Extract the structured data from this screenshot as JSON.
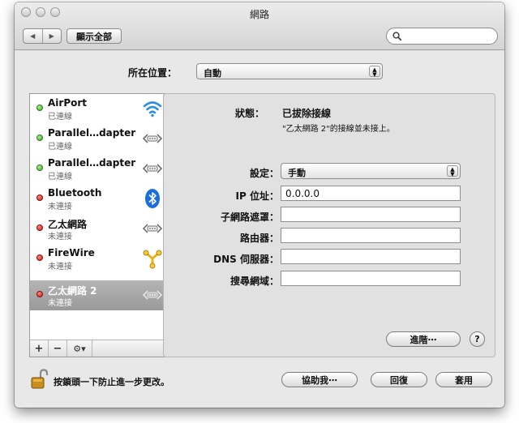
{
  "window": {
    "title": "網路"
  },
  "toolbar": {
    "back_symbol": "◀",
    "forward_symbol": "▶",
    "show_all_label": "顯示全部",
    "search_value": ""
  },
  "location": {
    "label": "所在位置：",
    "value": "自動"
  },
  "services": [
    {
      "name": "AirPort",
      "status": "已連線",
      "state": "green",
      "icon": "wifi-icon"
    },
    {
      "name": "Parallel…dapter",
      "status": "已連線",
      "state": "green",
      "icon": "ethernet-icon"
    },
    {
      "name": "Parallel…dapter",
      "status": "已連線",
      "state": "green",
      "icon": "ethernet-icon"
    },
    {
      "name": "Bluetooth",
      "status": "未連接",
      "state": "red",
      "icon": "bluetooth-icon"
    },
    {
      "name": "乙太網路",
      "status": "未連接",
      "state": "red",
      "icon": "ethernet-icon"
    },
    {
      "name": "FireWire",
      "status": "未連接",
      "state": "red",
      "icon": "firewire-icon"
    },
    {
      "name": "乙太網路 2",
      "status": "未連接",
      "state": "red",
      "icon": "ethernet-icon",
      "selected": true
    }
  ],
  "sidebar_toolbar": {
    "add": "+",
    "remove": "−",
    "gear": "⚙▾"
  },
  "detail": {
    "status_label": "狀態：",
    "status_value": "已拔除接線",
    "status_description": "\"乙太網路 2\"的接線並未接上。",
    "configure_label": "設定：",
    "configure_value": "手動",
    "ip_label": "IP 位址：",
    "ip_value": "0.0.0.0",
    "subnet_label": "子網路遮罩：",
    "subnet_value": "",
    "router_label": "路由器：",
    "router_value": "",
    "dns_label": "DNS 伺服器：",
    "dns_value": "",
    "search_domains_label": "搜尋網域：",
    "search_domains_value": "",
    "advanced_label": "進階⋯",
    "help_symbol": "?"
  },
  "footer": {
    "lock_text": "按鎖頭一下防止進一步更改。",
    "assist_label": "協助我⋯",
    "revert_label": "回復",
    "apply_label": "套用"
  },
  "colors": {
    "connected": "#2fa62a",
    "disconnected": "#d01818",
    "selected_row": "#a6a6a6",
    "bluetooth": "#1a6fe0",
    "firewire": "#e8b21a"
  }
}
